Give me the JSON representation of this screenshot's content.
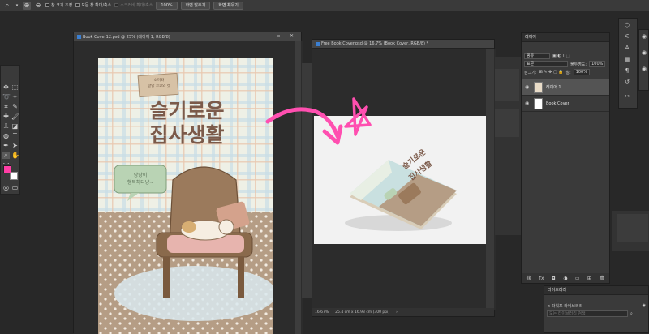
{
  "options_bar": {
    "check1_label": "창 크기 조정",
    "check2_label": "모든 창 확대/축소",
    "scrubby_label": "스크러비 확대/축소",
    "zoom_pct": "100%",
    "fit_btn": "화면 맞추기",
    "fill_btn": "화면 채우기"
  },
  "doc1": {
    "tab_title": "Book Cover12.psd @ 25% (레이어 1, RGB/8)",
    "cover_small_label_1": "소미와",
    "cover_small_label_2": "달냥 코코와 캣",
    "title_line1": "슬기로운",
    "title_line2": "집사생활",
    "bubble_line1": "냥냥이",
    "bubble_line2": "행복하다냥~"
  },
  "doc2": {
    "tab_title": "Free Book Cover.psd @ 16.7% (Book Cover, RGB/8) *",
    "mock_title_1": "슬기로운",
    "mock_title_2": "집사생활",
    "status_zoom": "16.67%",
    "status_info": "25.4 cm x 16.93 cm (300 ppi)"
  },
  "layers_panel": {
    "tab_label": "레이어",
    "kind_filter": "종류",
    "blend_mode": "표준",
    "opacity_label": "불투명도:",
    "opacity_value": "100%",
    "lock_label": "잠그기:",
    "fill_label": "칠:",
    "fill_value": "100%",
    "layers": [
      {
        "name": "레이어 1",
        "selected": true
      },
      {
        "name": "Book Cover",
        "selected": false
      }
    ],
    "footer_icons": [
      "link-icon",
      "fx-icon",
      "mask-icon",
      "adjustment-icon",
      "group-icon",
      "new-layer-icon",
      "trash-icon"
    ]
  },
  "libraries_panel": {
    "tab_label": "라이브러리",
    "current_library": "< 파워포 라이브러리",
    "search_placeholder": "모든 라이브러리 검색"
  },
  "colors": {
    "foreground": "#ff3ea5",
    "background": "#ffffff",
    "annotation": "#ff4fb0",
    "ps_accent": "#3b7fd1"
  }
}
